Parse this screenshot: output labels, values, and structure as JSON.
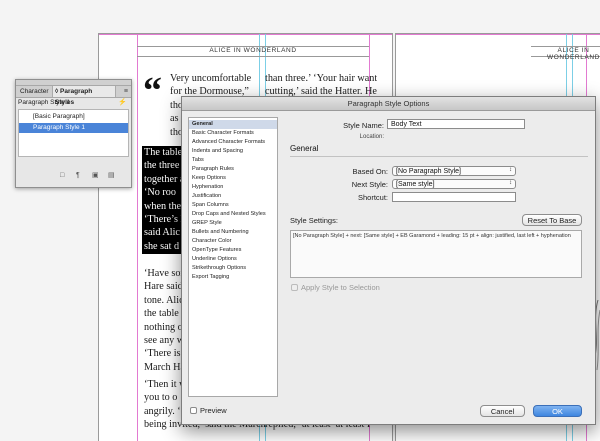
{
  "document": {
    "running_head_left": "ALICE IN WONDERLAND",
    "running_head_right": "ALICE IN WONDERLAND",
    "dropcap": "“",
    "left_column_top": [
      "Very uncomfortable",
      "for the Dormouse,”",
      "tho",
      "as i",
      "tho"
    ],
    "right_column_top": [
      "than three.’ ‘Your hair wants",
      "cutting,’ said the Hatter. He"
    ],
    "highlighted_lines": [
      "The table",
      "the three",
      "together a",
      "‘No roo",
      "when the",
      "‘There’s l",
      "said Alic",
      "she sat d"
    ],
    "middle_lines": [
      "‘Have som",
      "Hare said",
      "tone. Alic",
      "the table",
      "nothing o",
      "see any w",
      "‘There is",
      "March Ha"
    ],
    "bottom_lines": [
      "‘Then it w",
      "you to o",
      "angrily. ‘",
      "being invited,’ said the March"
    ],
    "bottom_right_line": "replied; ‘at least–at least I"
  },
  "panel": {
    "tab_character": "Character",
    "tab_paragraph": "◊ Paragraph Styles",
    "menu_icon": "≡",
    "current_style": "Paragraph Style 1",
    "items": [
      "[Basic Paragraph]",
      "Paragraph Style 1"
    ],
    "selected_index": 1
  },
  "dialog": {
    "title": "Paragraph Style Options",
    "categories": [
      "General",
      "Basic Character Formats",
      "Advanced Character Formats",
      "Indents and Spacing",
      "Tabs",
      "Paragraph Rules",
      "Keep Options",
      "Hyphenation",
      "Justification",
      "Span Columns",
      "Drop Caps and Nested Styles",
      "GREP Style",
      "Bullets and Numbering",
      "Character Color",
      "OpenType Features",
      "Underline Options",
      "Strikethrough Options",
      "Export Tagging"
    ],
    "selected_category": 0,
    "style_name_label": "Style Name:",
    "style_name_value": "Body Text",
    "location_label": "Location:",
    "section_general": "General",
    "based_on_label": "Based On:",
    "based_on_value": "[No Paragraph Style]",
    "next_style_label": "Next Style:",
    "next_style_value": "[Same style]",
    "shortcut_label": "Shortcut:",
    "shortcut_value": "",
    "style_settings_label": "Style Settings:",
    "reset_button": "Reset To Base",
    "style_settings_text": "[No Paragraph Style] + next: [Same style] + EB Garamond + leading: 15 pt + align: justified, last left + hyphenation",
    "apply_label": "Apply Style to Selection",
    "preview_label": "Preview",
    "cancel_button": "Cancel",
    "ok_button": "OK"
  },
  "colors": {
    "margin_guide": "#e27ad1",
    "column_guide": "#7ccfe6",
    "selection_blue": "#4a84d8",
    "ok_button": "#3e86e0"
  }
}
